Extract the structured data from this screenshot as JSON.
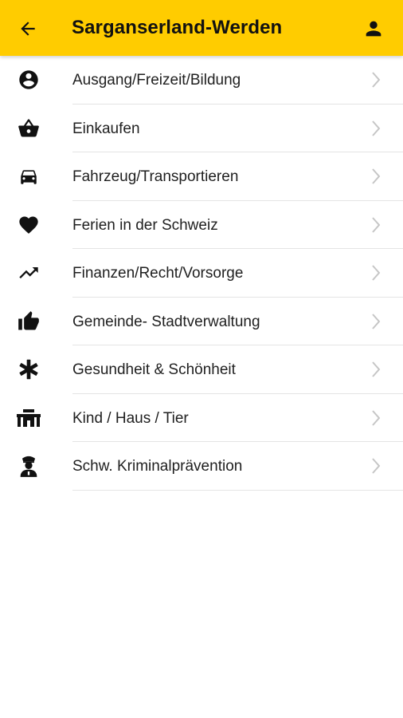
{
  "header": {
    "title": "Sarganserland-Werden",
    "back_icon": "arrow-left-icon",
    "profile_icon": "person-icon",
    "background_color": "#FFCC00"
  },
  "categories": [
    {
      "label": "Ausgang/Freizeit/Bildung",
      "icon": "account-circle-icon"
    },
    {
      "label": "Einkaufen",
      "icon": "shopping-basket-icon"
    },
    {
      "label": "Fahrzeug/Transportieren",
      "icon": "car-icon"
    },
    {
      "label": "Ferien in der Schweiz",
      "icon": "heart-icon"
    },
    {
      "label": "Finanzen/Recht/Vorsorge",
      "icon": "trending-up-icon"
    },
    {
      "label": "Gemeinde- Stadtverwaltung",
      "icon": "thumbs-up-icon"
    },
    {
      "label": "Gesundheit & Schönheit",
      "icon": "asterisk-icon"
    },
    {
      "label": "Kind / Haus / Tier",
      "icon": "house-icon"
    },
    {
      "label": "Schw. Kriminalprävention",
      "icon": "police-officer-icon"
    }
  ]
}
